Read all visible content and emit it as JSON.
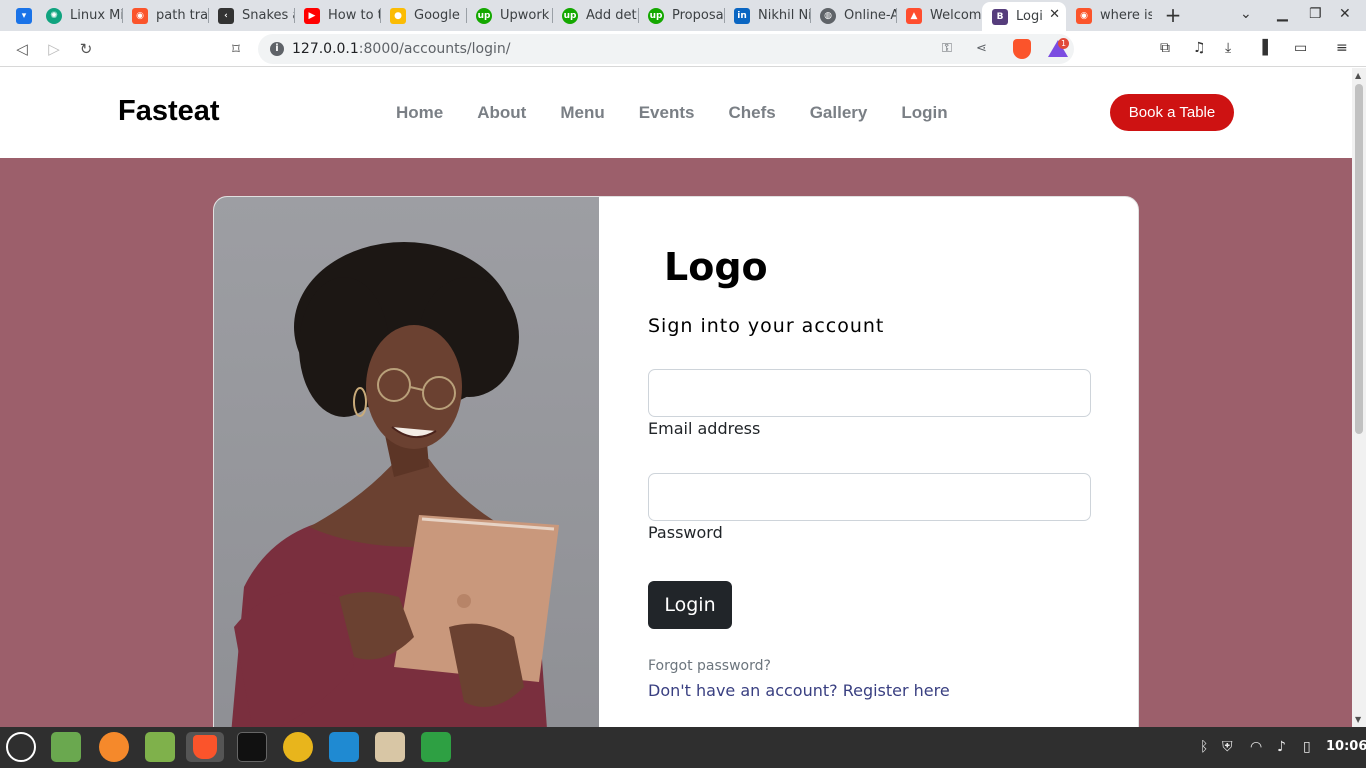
{
  "browser": {
    "tabs": [
      {
        "label": "",
        "icon": "brave-menu-icon",
        "color": "#1a73e8"
      },
      {
        "label": "Linux Mi",
        "icon": "openai-icon",
        "color": "#10a37f"
      },
      {
        "label": "path tra",
        "icon": "brave-shield-icon",
        "color": "#fb542b"
      },
      {
        "label": "Snakes a",
        "icon": "snake-icon",
        "color": "#333333"
      },
      {
        "label": "How to t",
        "icon": "youtube-icon",
        "color": "#ff0000"
      },
      {
        "label": "Google",
        "icon": "google-keep-icon",
        "color": "#fbbc04"
      },
      {
        "label": "Upwork",
        "icon": "upwork-icon",
        "color": "#14a800"
      },
      {
        "label": "Add det",
        "icon": "upwork-icon",
        "color": "#14a800"
      },
      {
        "label": "Proposa",
        "icon": "upwork-icon",
        "color": "#14a800"
      },
      {
        "label": "Nikhil Ni",
        "icon": "linkedin-icon",
        "color": "#0a66c2"
      },
      {
        "label": "Online-A",
        "icon": "globe-icon",
        "color": "#5f6368"
      },
      {
        "label": "Welcom",
        "icon": "flame-icon",
        "color": "#ff4d2e"
      },
      {
        "label": "Logi",
        "icon": "bootstrap-icon",
        "color": "#563d7c",
        "active": true
      },
      {
        "label": "where is",
        "icon": "brave-shield-icon",
        "color": "#fb542b"
      }
    ],
    "close_glyph": "✕",
    "new_tab_glyph": "+",
    "url_host": "127.0.0.1",
    "url_rest": ":8000/accounts/login/",
    "rewards_badge": "1"
  },
  "site": {
    "brand": "Fasteat",
    "nav": [
      "Home",
      "About",
      "Menu",
      "Events",
      "Chefs",
      "Gallery",
      "Login"
    ],
    "cta": "Book a Table",
    "colors": {
      "accent": "#ce1212",
      "background": "#9c5f6b",
      "button": "#212529",
      "link": "#393f81"
    }
  },
  "login": {
    "logo": "Logo",
    "heading": "Sign into your account",
    "email_label": "Email address",
    "email_value": "",
    "password_label": "Password",
    "password_value": "",
    "submit": "Login",
    "forgot": "Forgot password?",
    "register": "Don't have an account? Register here"
  },
  "taskbar": {
    "apps": [
      "mint-menu-icon",
      "show-desktop-icon",
      "firefox-icon",
      "files-icon",
      "brave-icon",
      "terminal-icon",
      "bolt-app-icon",
      "vscode-icon",
      "update-manager-icon",
      "shield-app-icon"
    ],
    "clock": "10:06"
  }
}
